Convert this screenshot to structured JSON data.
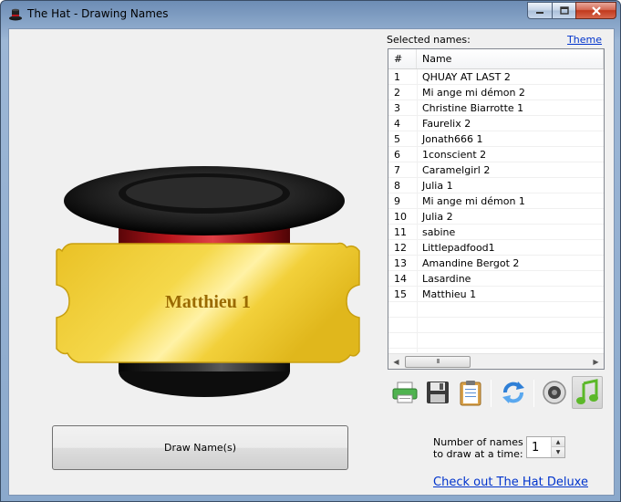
{
  "window": {
    "title": "The Hat - Drawing Names",
    "controls": {
      "minimize": "minimize",
      "maximize": "maximize",
      "close": "close"
    }
  },
  "hat": {
    "ticket_name": "Matthieu 1"
  },
  "list": {
    "label": "Selected names:",
    "theme_link": "Theme",
    "columns": {
      "num": "#",
      "name": "Name"
    },
    "rows": [
      {
        "num": "1",
        "name": "QHUAY AT LAST 2"
      },
      {
        "num": "2",
        "name": "Mi ange mi démon 2"
      },
      {
        "num": "3",
        "name": "Christine Biarrotte 1"
      },
      {
        "num": "4",
        "name": "Faurelix 2"
      },
      {
        "num": "5",
        "name": "Jonath666 1"
      },
      {
        "num": "6",
        "name": "1conscient 2"
      },
      {
        "num": "7",
        "name": "Caramelgirl 2"
      },
      {
        "num": "8",
        "name": "Julia 1"
      },
      {
        "num": "9",
        "name": "Mi ange mi démon 1"
      },
      {
        "num": "10",
        "name": "Julia 2"
      },
      {
        "num": "11",
        "name": "sabine"
      },
      {
        "num": "12",
        "name": "Littlepadfood1"
      },
      {
        "num": "13",
        "name": "Amandine Bergot 2"
      },
      {
        "num": "14",
        "name": "Lasardine"
      },
      {
        "num": "15",
        "name": "Matthieu 1"
      }
    ],
    "scroll_thumb_glyph": "III"
  },
  "toolbar": {
    "icons": [
      "printer-icon",
      "save-icon",
      "clipboard-icon",
      "refresh-icon",
      "speaker-icon",
      "music-note-icon"
    ],
    "music_active": true
  },
  "controls": {
    "draw_button": "Draw Name(s)",
    "num_label_line1": "Number of names",
    "num_label_line2": "to draw at a time:",
    "num_value": "1",
    "deluxe_link": "Check out The Hat Deluxe"
  },
  "colors": {
    "ticket_gold": "#f2cf3a",
    "ticket_text": "#9a6a00",
    "hat_band": "#b8161c",
    "link": "#0033cc"
  }
}
